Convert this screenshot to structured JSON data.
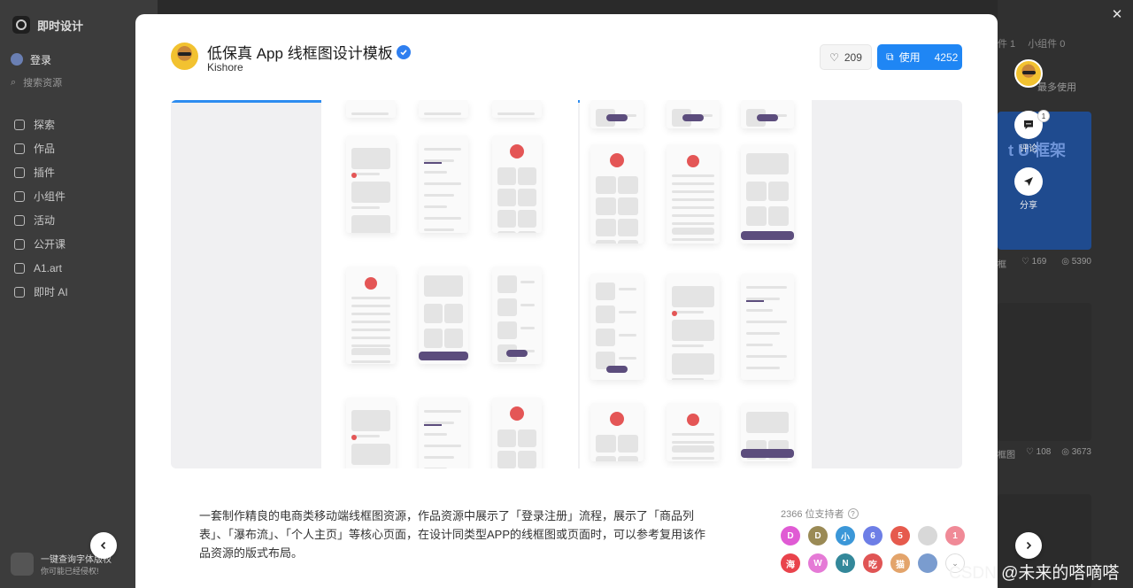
{
  "background": {
    "app_name": "即时设计",
    "login": "登录",
    "search_placeholder": "搜索资源",
    "nav": [
      "探索",
      "作品",
      "插件",
      "小组件",
      "活动",
      "公开课",
      "A1.art",
      "即时 AI"
    ],
    "promo_title": "一键查询字体版权",
    "promo_sub": "你可能已经侵权!",
    "tabs": [
      "件 1",
      "小组件 0"
    ],
    "more": "最多使用",
    "card1_text": "t U 框架",
    "stat1": {
      "likes": "169",
      "views": "5390"
    },
    "stat2": {
      "likes": "108",
      "views": "3673"
    }
  },
  "modal": {
    "title": "低保真 App 线框图设计模板",
    "author": "Kishore",
    "likes": "209",
    "use_label": "使用",
    "use_count": "4252",
    "progress": 0.58,
    "description": "一套制作精良的电商类移动端线框图资源，作品资源中展示了「登录注册」流程，展示了「商品列表」、「瀑布流」、「个人主页」等核心页面，在设计同类型APP的线框图或页面时，可以参考复用该作品资源的版式布局。",
    "supporters_label": "2366 位支持者",
    "supporter_avatars": [
      {
        "text": "D",
        "color": "#e05bd4"
      },
      {
        "text": "D",
        "color": "#9a8a55"
      },
      {
        "text": "小",
        "color": "#3b97d8"
      },
      {
        "text": "6",
        "color": "#6d7ee6"
      },
      {
        "text": "5",
        "color": "#e65a4d"
      },
      {
        "text": "",
        "color": "#d8d8d8"
      },
      {
        "text": "1",
        "color": "#f08a97"
      },
      {
        "text": "海",
        "color": "#e9434c"
      },
      {
        "text": "W",
        "color": "#e57ad6"
      },
      {
        "text": "N",
        "color": "#33889a"
      },
      {
        "text": "吃",
        "color": "#e05555"
      },
      {
        "text": "猫",
        "color": "#e3a46b"
      },
      {
        "text": "",
        "color": "#7a9ccf"
      }
    ]
  },
  "actions": {
    "comment_label": "评论",
    "comment_count": "1",
    "share_label": "分享"
  },
  "watermark": "CSDN @未来的嗒嘀嗒"
}
